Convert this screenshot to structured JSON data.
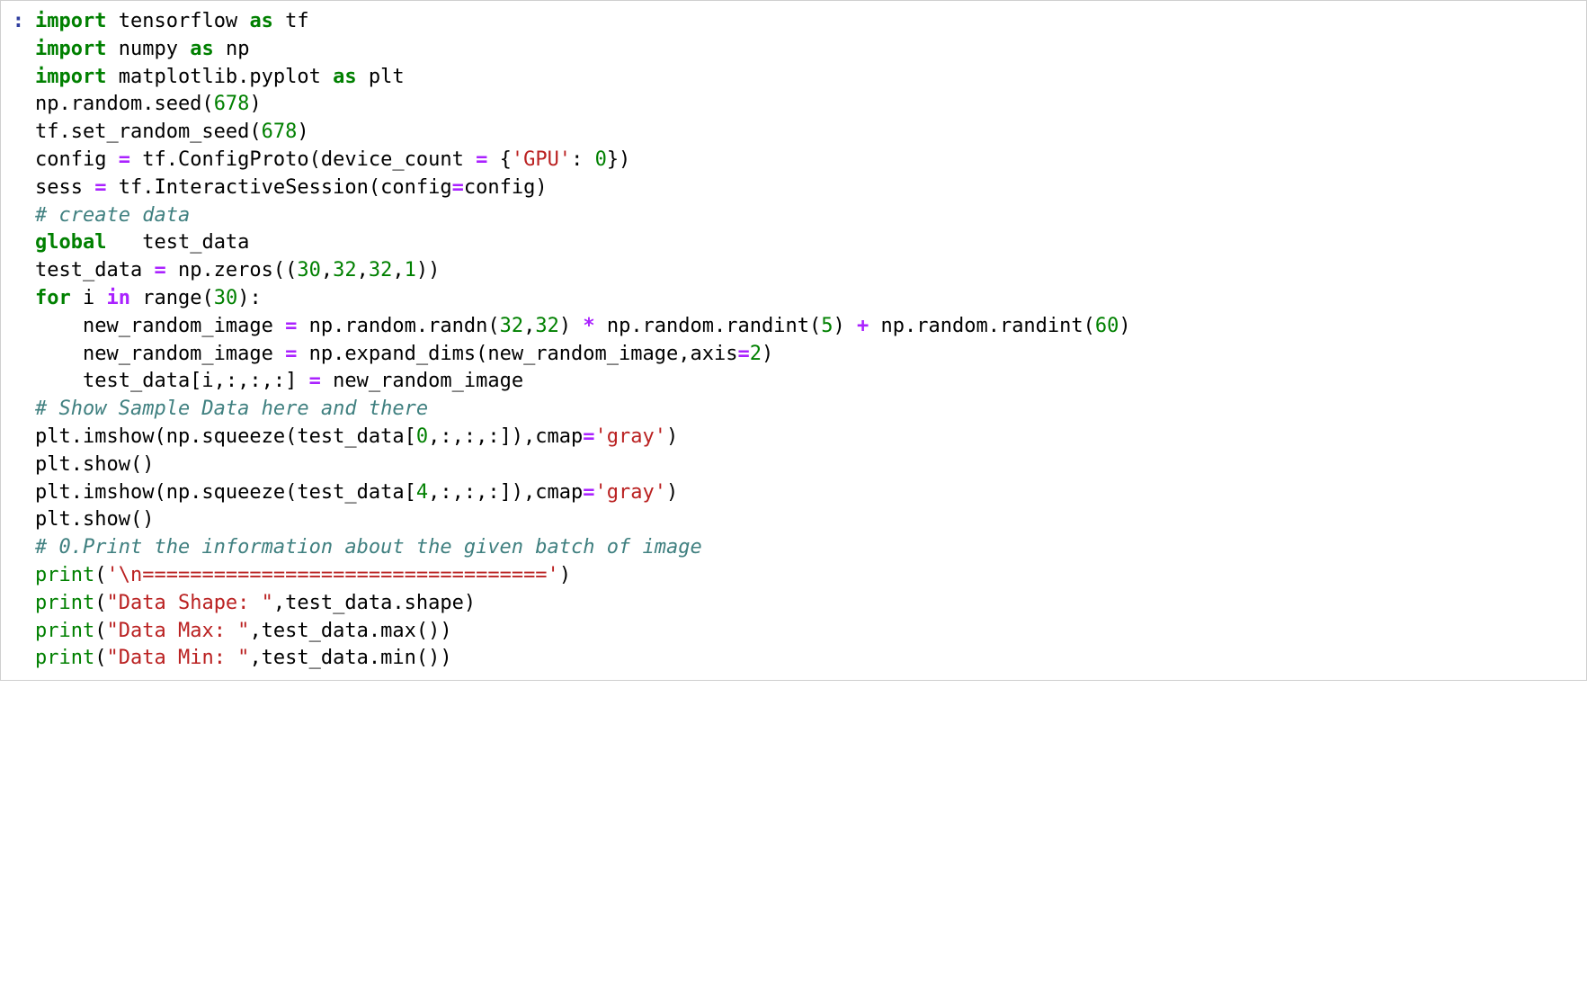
{
  "prompt": ":",
  "code": {
    "lines": [
      {
        "tokens": [
          [
            "kw",
            "import"
          ],
          [
            "",
            " tensorflow "
          ],
          [
            "kw",
            "as"
          ],
          [
            "",
            " tf"
          ]
        ]
      },
      {
        "tokens": [
          [
            "kw",
            "import"
          ],
          [
            "",
            " numpy "
          ],
          [
            "kw",
            "as"
          ],
          [
            "",
            " np"
          ]
        ]
      },
      {
        "tokens": [
          [
            "kw",
            "import"
          ],
          [
            "",
            " matplotlib.pyplot "
          ],
          [
            "kw",
            "as"
          ],
          [
            "",
            " plt"
          ]
        ]
      },
      {
        "tokens": [
          [
            "",
            "np.random.seed("
          ],
          [
            "num",
            "678"
          ],
          [
            "",
            ")"
          ]
        ]
      },
      {
        "tokens": [
          [
            "",
            "tf.set_random_seed("
          ],
          [
            "num",
            "678"
          ],
          [
            "",
            ")"
          ]
        ]
      },
      {
        "tokens": [
          [
            "",
            "config "
          ],
          [
            "op",
            "="
          ],
          [
            "",
            " tf.ConfigProto(device_count "
          ],
          [
            "op",
            "="
          ],
          [
            "",
            " {"
          ],
          [
            "str",
            "'GPU'"
          ],
          [
            "",
            ": "
          ],
          [
            "num",
            "0"
          ],
          [
            "",
            "})"
          ]
        ]
      },
      {
        "tokens": [
          [
            "",
            "sess "
          ],
          [
            "op",
            "="
          ],
          [
            "",
            " tf.InteractiveSession(config"
          ],
          [
            "op",
            "="
          ],
          [
            "",
            "config)"
          ]
        ]
      },
      {
        "tokens": [
          [
            "",
            ""
          ]
        ]
      },
      {
        "tokens": [
          [
            "com",
            "# create data"
          ]
        ]
      },
      {
        "tokens": [
          [
            "kw",
            "global"
          ],
          [
            "",
            "   test_data"
          ]
        ]
      },
      {
        "tokens": [
          [
            "",
            "test_data "
          ],
          [
            "op",
            "="
          ],
          [
            "",
            " np.zeros(("
          ],
          [
            "num",
            "30"
          ],
          [
            "",
            ","
          ],
          [
            "num",
            "32"
          ],
          [
            "",
            ","
          ],
          [
            "num",
            "32"
          ],
          [
            "",
            ","
          ],
          [
            "num",
            "1"
          ],
          [
            "",
            "))"
          ]
        ]
      },
      {
        "tokens": [
          [
            "kw",
            "for"
          ],
          [
            "",
            " i "
          ],
          [
            "op",
            "in"
          ],
          [
            "",
            " range("
          ],
          [
            "num",
            "30"
          ],
          [
            "",
            "):"
          ]
        ]
      },
      {
        "tokens": [
          [
            "",
            "    new_random_image "
          ],
          [
            "op",
            "="
          ],
          [
            "",
            " np.random.randn("
          ],
          [
            "num",
            "32"
          ],
          [
            "",
            ","
          ],
          [
            "num",
            "32"
          ],
          [
            "",
            ") "
          ],
          [
            "op",
            "*"
          ],
          [
            "",
            " np.random.randint("
          ],
          [
            "num",
            "5"
          ],
          [
            "",
            ") "
          ],
          [
            "op",
            "+"
          ],
          [
            "",
            " np.random.randint("
          ],
          [
            "num",
            "60"
          ],
          [
            "",
            ")"
          ]
        ]
      },
      {
        "tokens": [
          [
            "",
            "    new_random_image "
          ],
          [
            "op",
            "="
          ],
          [
            "",
            " np.expand_dims(new_random_image,axis"
          ],
          [
            "op",
            "="
          ],
          [
            "num",
            "2"
          ],
          [
            "",
            ")"
          ]
        ]
      },
      {
        "tokens": [
          [
            "",
            "    test_data[i,:,:,:] "
          ],
          [
            "op",
            "="
          ],
          [
            "",
            " new_random_image"
          ]
        ]
      },
      {
        "tokens": [
          [
            "",
            ""
          ]
        ]
      },
      {
        "tokens": [
          [
            "com",
            "# Show Sample Data here and there"
          ]
        ]
      },
      {
        "tokens": [
          [
            "",
            "plt.imshow(np.squeeze(test_data["
          ],
          [
            "num",
            "0"
          ],
          [
            "",
            ",:,:,:]),cmap"
          ],
          [
            "op",
            "="
          ],
          [
            "str",
            "'gray'"
          ],
          [
            "",
            ")"
          ]
        ]
      },
      {
        "tokens": [
          [
            "",
            "plt.show()"
          ]
        ]
      },
      {
        "tokens": [
          [
            "",
            ""
          ]
        ]
      },
      {
        "tokens": [
          [
            "",
            "plt.imshow(np.squeeze(test_data["
          ],
          [
            "num",
            "4"
          ],
          [
            "",
            ",:,:,:]),cmap"
          ],
          [
            "op",
            "="
          ],
          [
            "str",
            "'gray'"
          ],
          [
            "",
            ")"
          ]
        ]
      },
      {
        "tokens": [
          [
            "",
            "plt.show()"
          ]
        ]
      },
      {
        "tokens": [
          [
            "",
            ""
          ]
        ]
      },
      {
        "tokens": [
          [
            "com",
            "# 0.Print the information about the given batch of image"
          ]
        ]
      },
      {
        "tokens": [
          [
            "bi",
            "print"
          ],
          [
            "",
            "("
          ],
          [
            "str",
            "'\\n=================================='"
          ],
          [
            "",
            ")"
          ]
        ]
      },
      {
        "tokens": [
          [
            "bi",
            "print"
          ],
          [
            "",
            "("
          ],
          [
            "str",
            "\"Data Shape: \""
          ],
          [
            "",
            ",test_data.shape)"
          ]
        ]
      },
      {
        "tokens": [
          [
            "bi",
            "print"
          ],
          [
            "",
            "("
          ],
          [
            "str",
            "\"Data Max: \""
          ],
          [
            "",
            ",test_data.max())"
          ]
        ]
      },
      {
        "tokens": [
          [
            "bi",
            "print"
          ],
          [
            "",
            "("
          ],
          [
            "str",
            "\"Data Min: \""
          ],
          [
            "",
            ",test_data.min())"
          ]
        ]
      }
    ]
  }
}
